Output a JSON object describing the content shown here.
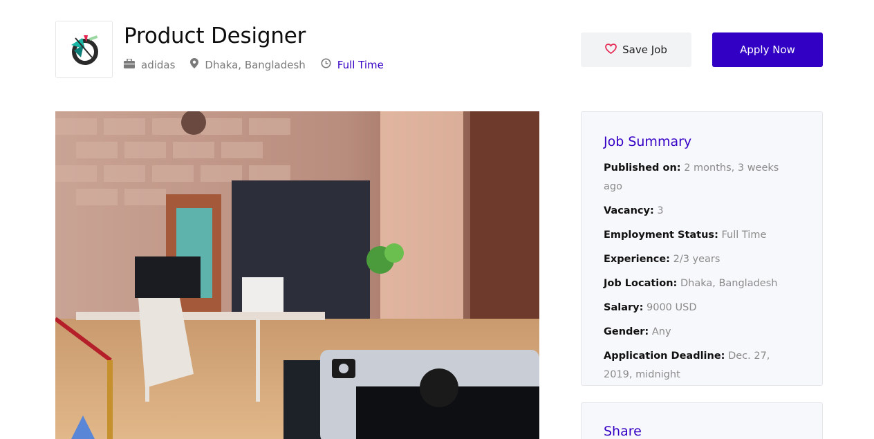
{
  "job": {
    "title": "Product Designer",
    "company": "adidas",
    "location": "Dhaka, Bangladesh",
    "type": "Full Time"
  },
  "actions": {
    "save_label": "Save Job",
    "apply_label": "Apply Now"
  },
  "summary": {
    "heading": "Job Summary",
    "rows": [
      {
        "label": "Published on:",
        "value": "2 months, 3 weeks ago"
      },
      {
        "label": "Vacancy:",
        "value": "3"
      },
      {
        "label": "Employment Status:",
        "value": "Full Time"
      },
      {
        "label": "Experience:",
        "value": "2/3 years"
      },
      {
        "label": "Job Location:",
        "value": "Dhaka, Bangladesh"
      },
      {
        "label": "Salary:",
        "value": "9000 USD"
      },
      {
        "label": "Gender:",
        "value": "Any"
      },
      {
        "label": "Application Deadline:",
        "value": "Dec. 27, 2019, midnight"
      }
    ]
  },
  "share": {
    "heading": "Share"
  },
  "colors": {
    "accent": "#3200c4",
    "heart": "#e5254f",
    "panel_bg": "#f7f8fb"
  },
  "icons": [
    "briefcase-icon",
    "map-pin-icon",
    "clock-icon",
    "heart-icon",
    "company-logo"
  ]
}
